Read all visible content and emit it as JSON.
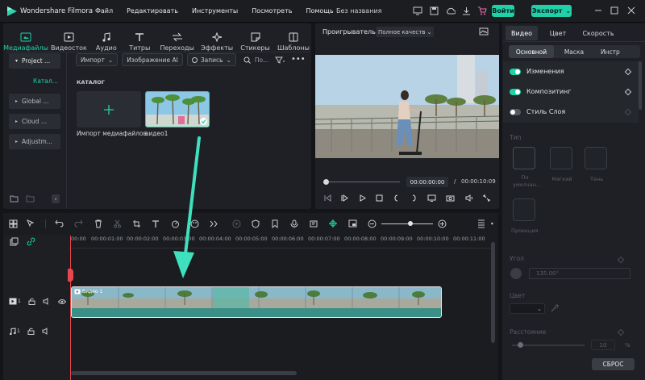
{
  "app": {
    "name": "Wondershare Filmora",
    "title": "Без названия"
  },
  "menu": [
    "Файл",
    "Редактировать",
    "Инструменты",
    "Посмотреть",
    "Помощь"
  ],
  "topbar": {
    "login_label": "Войти",
    "export_label": "Экспорт"
  },
  "media_tabs": [
    {
      "label": "Медиафайлы",
      "icon": "media-icon"
    },
    {
      "label": "Видеосток",
      "icon": "stock-video-icon"
    },
    {
      "label": "Аудио",
      "icon": "music-note-icon"
    },
    {
      "label": "Титры",
      "icon": "text-icon"
    },
    {
      "label": "Переходы",
      "icon": "transitions-icon"
    },
    {
      "label": "Эффекты",
      "icon": "effects-icon"
    },
    {
      "label": "Стикеры",
      "icon": "stickers-icon"
    },
    {
      "label": "Шаблоны",
      "icon": "templates-icon"
    }
  ],
  "sidebar": {
    "items": [
      "Project ...",
      "Катал...",
      "Global ...",
      "Cloud ...",
      "Adjustm..."
    ]
  },
  "media_toolbar": {
    "import_label": "Импорт",
    "ai_image_label": "Изображение AI",
    "record_label": "Запись",
    "search_placeholder": "По..."
  },
  "catalog": {
    "heading": "КАТАЛОГ",
    "import_label": "Импорт медиафайлов",
    "clip_name": "видео1"
  },
  "player": {
    "label": "Проигрыватель",
    "quality": "Полное качеств",
    "time_current": "00:00:00:00",
    "time_separator": "/",
    "time_total": "00:00:10:09"
  },
  "inspector": {
    "tabs": [
      "Видео",
      "Цвет",
      "Скорость"
    ],
    "subtabs": [
      "Основной",
      "Маска",
      "Инстр"
    ],
    "rows": [
      {
        "label": "Изменения",
        "on": true
      },
      {
        "label": "Композитинг",
        "on": true
      },
      {
        "label": "Стиль Слоя",
        "on": false
      }
    ],
    "type_heading": "Тип",
    "types": [
      "По умолчан...",
      "Мягкий",
      "Тень"
    ],
    "projection_label": "Проекция",
    "angle_heading": "Угол",
    "angle_value": "135.00°",
    "color_heading": "Цвет",
    "distance_heading": "Расстояние",
    "distance_value": "10",
    "distance_unit": "%",
    "reset_label": "СБРОС"
  },
  "timeline": {
    "ruler": [
      "00:00",
      "00:00:01:00",
      "00:00:02:00",
      "00:00:03:00",
      "00:00:04:00",
      "00:00:05:00",
      "00:00:06:00",
      "00:00:07:00",
      "00:00:08:00",
      "00:00:09:00",
      "00:00:10:00",
      "00:00:11:00"
    ],
    "clip_label": "Видео 1",
    "video_track_index": "1",
    "audio_track_index": "1"
  },
  "colors": {
    "accent": "#1fd1a8",
    "playhead": "#e8484d",
    "bg": "#131519",
    "panel": "#1e2025"
  }
}
